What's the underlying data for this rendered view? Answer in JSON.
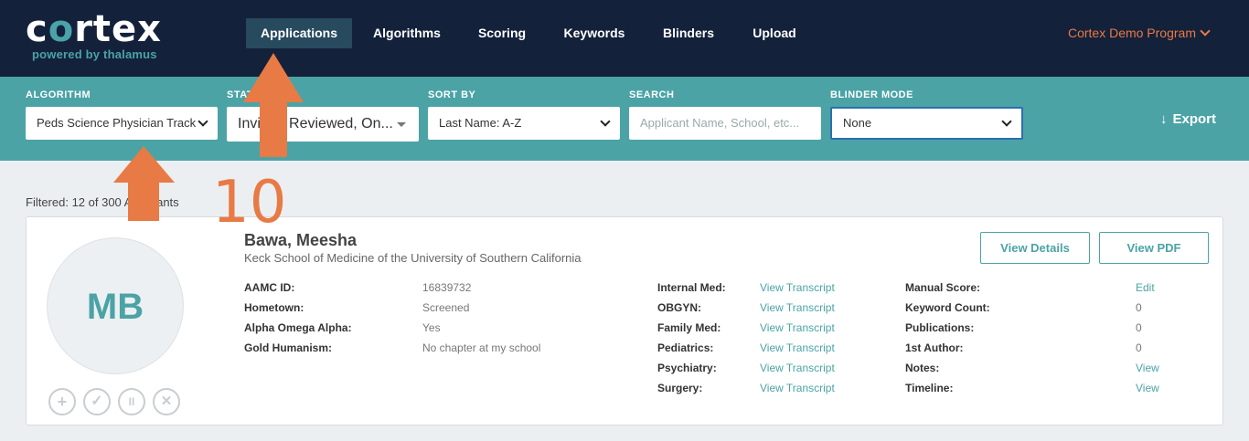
{
  "logo": {
    "word": "cortex",
    "sub": "powered by thalamus"
  },
  "nav": {
    "items": [
      "Applications",
      "Algorithms",
      "Scoring",
      "Keywords",
      "Blinders",
      "Upload"
    ],
    "program": "Cortex Demo Program"
  },
  "filters": {
    "algorithm": {
      "label": "ALGORITHM",
      "value": "Peds Science Physician Track"
    },
    "status": {
      "label": "STATUS",
      "value": "Invited, Reviewed, On..."
    },
    "sort": {
      "label": "SORT BY",
      "value": "Last Name: A-Z"
    },
    "search": {
      "label": "SEARCH",
      "placeholder": "Applicant Name, School, etc..."
    },
    "blinder": {
      "label": "BLINDER MODE",
      "value": "None"
    },
    "export": "Export"
  },
  "filtered_text": "Filtered: 12 of 300 Applicants",
  "annotation_number": "10",
  "applicant": {
    "initials": "MB",
    "name": "Bawa, Meesha",
    "school": "Keck School of Medicine of the University of Southern California",
    "buttons": {
      "details": "View Details",
      "pdf": "View PDF"
    },
    "actions": [
      "+",
      "✓",
      "II",
      "✕"
    ],
    "info": [
      {
        "label": "AAMC ID:",
        "value": "16839732"
      },
      {
        "label": "Hometown:",
        "value": "Screened"
      },
      {
        "label": "Alpha Omega Alpha:",
        "value": "Yes"
      },
      {
        "label": "Gold Humanism:",
        "value": "No chapter at my school"
      }
    ],
    "transcripts": [
      {
        "label": "Internal Med:",
        "link": "View Transcript"
      },
      {
        "label": "OBGYN:",
        "link": "View Transcript"
      },
      {
        "label": "Family Med:",
        "link": "View Transcript"
      },
      {
        "label": "Pediatrics:",
        "link": "View Transcript"
      },
      {
        "label": "Psychiatry:",
        "link": "View Transcript"
      },
      {
        "label": "Surgery:",
        "link": "View Transcript"
      }
    ],
    "scores": [
      {
        "label": "Manual Score:",
        "value": "Edit",
        "link": true
      },
      {
        "label": "Keyword Count:",
        "value": "0",
        "link": false
      },
      {
        "label": "Publications:",
        "value": "0",
        "link": false
      },
      {
        "label": "1st Author:",
        "value": "0",
        "link": false
      },
      {
        "label": "Notes:",
        "value": "View",
        "link": true
      },
      {
        "label": "Timeline:",
        "value": "View",
        "link": true
      }
    ]
  },
  "colors": {
    "nav_bg": "#14213a",
    "teal": "#4ba3a6",
    "accent_orange": "#e87a45"
  }
}
